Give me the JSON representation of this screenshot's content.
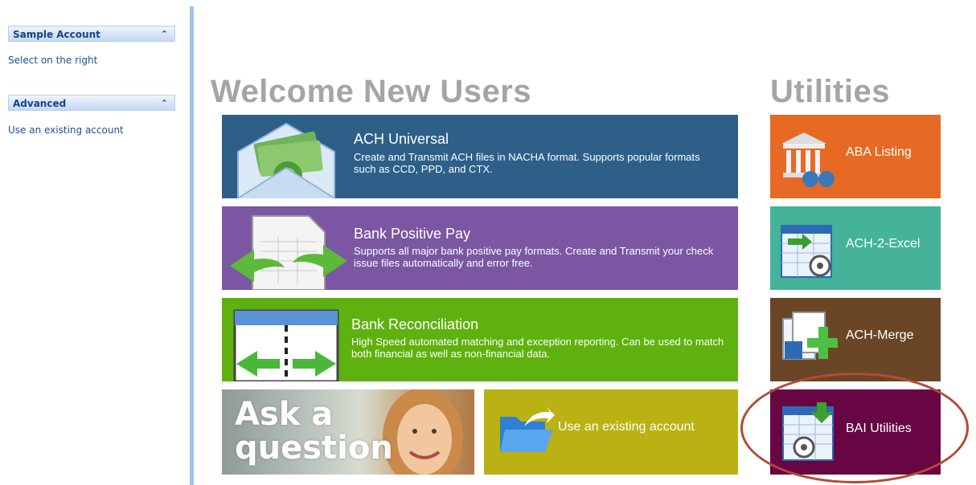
{
  "sidebar": {
    "panels": [
      {
        "title": "Sample Account",
        "link": "Select on the right"
      },
      {
        "title": "Advanced",
        "link": "Use an existing account"
      }
    ]
  },
  "welcome": {
    "heading": "Welcome New Users",
    "tiles": [
      {
        "title": "ACH Universal",
        "description": "Create and Transmit ACH files in NACHA format. Supports popular formats such as CCD, PPD, and CTX.",
        "color": "#2d5f89"
      },
      {
        "title": "Bank Positive Pay",
        "description": "Supports all major bank positive pay formats. Create and Transmit your check issue files automatically and error free.",
        "color": "#7b56a3"
      },
      {
        "title": "Bank Reconciliation",
        "description": "High Speed automated matching and exception reporting. Can be used to match both financial as well as non-financial data.",
        "color": "#5fb10f"
      }
    ],
    "ask": {
      "text": "Ask a question"
    },
    "existing": {
      "label": "Use an existing account",
      "color": "#b9b212"
    }
  },
  "utilities": {
    "heading": "Utilities",
    "tiles": [
      {
        "label": "ABA Listing",
        "color": "#e66a24",
        "icon": "bank-binoculars-icon"
      },
      {
        "label": "ACH-2-Excel",
        "color": "#44b399",
        "icon": "spreadsheet-gear-icon"
      },
      {
        "label": "ACH-Merge",
        "color": "#6a4626",
        "icon": "merge-documents-icon"
      },
      {
        "label": "BAI Utilities",
        "color": "#680543",
        "icon": "spreadsheet-gear-icon"
      }
    ]
  }
}
